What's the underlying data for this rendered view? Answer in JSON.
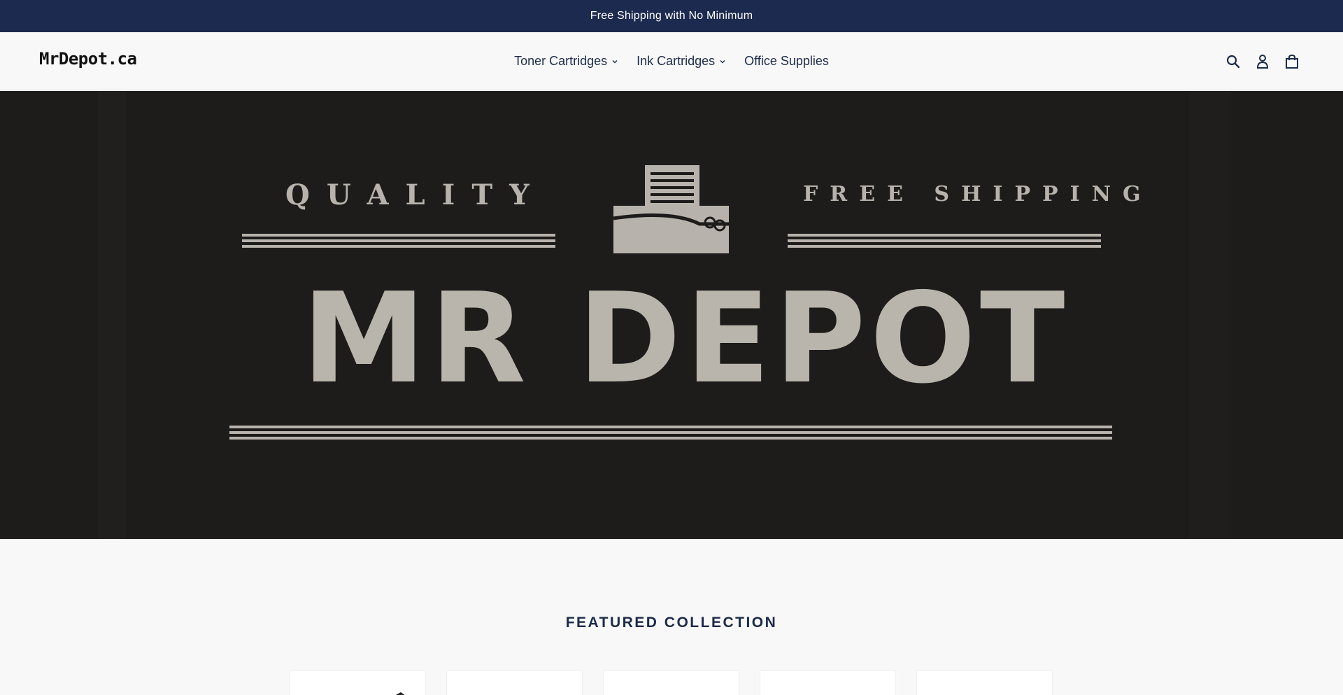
{
  "announcement": {
    "text": "Free Shipping with No Minimum"
  },
  "header": {
    "logo": "MrDepot.ca",
    "nav": [
      {
        "label": "Toner Cartridges",
        "has_dropdown": true
      },
      {
        "label": "Ink Cartridges",
        "has_dropdown": true
      },
      {
        "label": "Office Supplies",
        "has_dropdown": false
      }
    ],
    "icons": [
      "search-icon",
      "account-icon",
      "cart-icon"
    ]
  },
  "hero": {
    "quality": "QUALITY",
    "shipping": "FREE SHIPPING",
    "brand": "MR DEPOT",
    "background_color": "#1d1c1a",
    "text_color": "#b9b4ac"
  },
  "featured": {
    "title": "FEATURED COLLECTION",
    "cards": [
      {
        "id": 1
      },
      {
        "id": 2
      },
      {
        "id": 3
      },
      {
        "id": 4
      },
      {
        "id": 5
      }
    ]
  },
  "colors": {
    "brand_navy": "#1c2a4f",
    "page_bg": "#f8f8f8"
  }
}
